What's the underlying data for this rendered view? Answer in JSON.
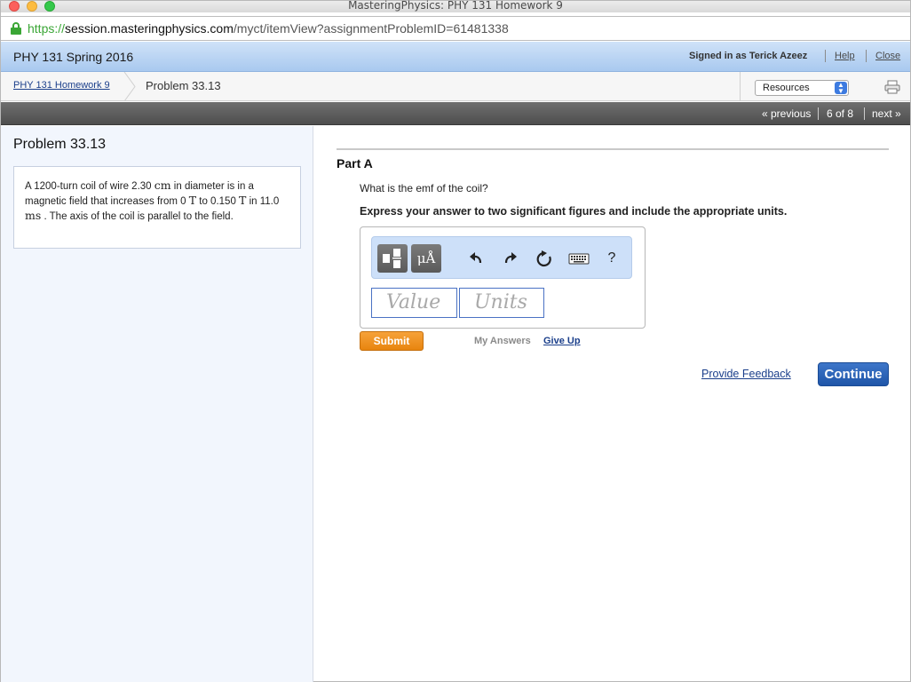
{
  "window": {
    "title": "MasteringPhysics: PHY 131 Homework 9"
  },
  "urlbar": {
    "scheme": "https://",
    "host": "session.masteringphysics.com",
    "path": "/myct/itemView?assignmentProblemID=61481338"
  },
  "header": {
    "course": "PHY 131 Spring 2016",
    "signed_in": "Signed in as Terick Azeez",
    "help": "Help",
    "close": "Close"
  },
  "breadcrumb": {
    "assignment": "PHY 131 Homework 9",
    "current": "Problem 33.13",
    "resources_label": "Resources"
  },
  "nav": {
    "previous": "« previous",
    "position": "6 of 8",
    "next": "next »"
  },
  "problem": {
    "title": "Problem 33.13",
    "text_1": "A 1200-turn coil of wire 2.30 ",
    "unit_cm": "cm",
    "text_2": " in diameter is in a magnetic field that increases from 0 ",
    "unit_T1": "T",
    "text_3": " to 0.150 ",
    "unit_T2": "T",
    "text_4": " in 11.0 ",
    "unit_ms": "ms",
    "text_5": " . The axis of the coil is parallel to the field."
  },
  "part": {
    "label": "Part A",
    "question": "What is the emf of the coil?",
    "instruction": "Express your answer to two significant figures and include the appropriate units.",
    "value_placeholder": "Value",
    "units_placeholder": "Units",
    "units_tool_label": "μÅ",
    "help_tool_label": "?"
  },
  "actions": {
    "submit": "Submit",
    "my_answers": "My Answers",
    "give_up": "Give Up",
    "feedback": "Provide Feedback",
    "continue": "Continue"
  },
  "colors": {
    "header_blue": "#a9c9ef",
    "submit_orange": "#e8850f",
    "continue_blue": "#1f55a8",
    "secure_green": "#3aa635"
  }
}
